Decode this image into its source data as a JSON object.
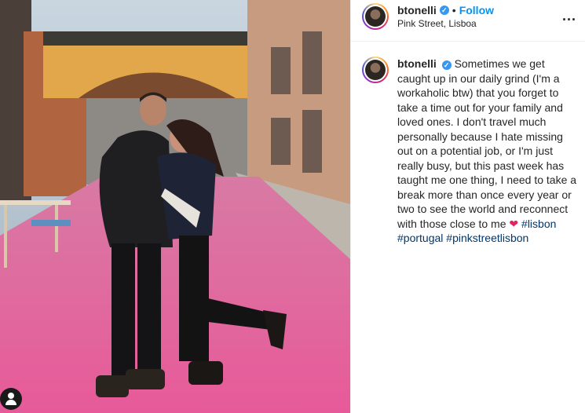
{
  "post": {
    "username": "btonelli",
    "verified_mark": "✓",
    "separator": "•",
    "follow_label": "Follow",
    "location": "Pink Street, Lisboa",
    "more_label": "...",
    "caption": {
      "text": "Sometimes we get caught up in our daily grind (I'm a workaholic btw) that you forget to take a time out for your family and loved ones. I don't travel much personally because I hate missing out on a potential job, or I'm just really busy, but this past week has taught me one thing, I need to take a break more than once every year or two to see the world and reconnect with those close to me",
      "emoji": "❤",
      "hashtags": [
        "#lisbon",
        "#portugal",
        "#pinkstreetlisbon"
      ]
    }
  },
  "photo": {
    "street_color": "#e36aa1",
    "icons": [
      "user-tag-icon"
    ]
  },
  "colors": {
    "follow": "#0095f6",
    "hashtag": "#00376b",
    "verified": "#3897f0",
    "heart": "#e0245e"
  }
}
